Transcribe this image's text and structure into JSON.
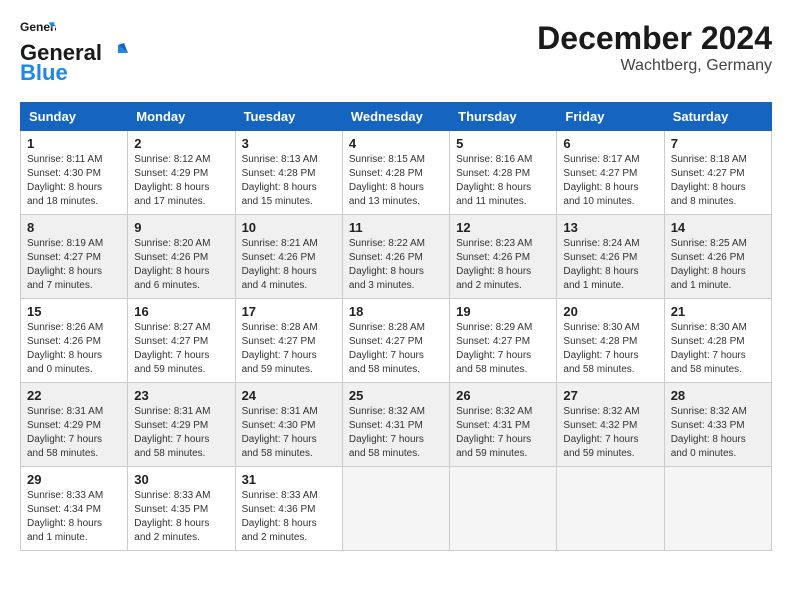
{
  "logo": {
    "line1": "General",
    "line2": "Blue"
  },
  "title": "December 2024",
  "location": "Wachtberg, Germany",
  "days_of_week": [
    "Sunday",
    "Monday",
    "Tuesday",
    "Wednesday",
    "Thursday",
    "Friday",
    "Saturday"
  ],
  "weeks": [
    [
      {
        "day": "1",
        "sunrise": "8:11 AM",
        "sunset": "4:30 PM",
        "daylight": "8 hours and 18 minutes."
      },
      {
        "day": "2",
        "sunrise": "8:12 AM",
        "sunset": "4:29 PM",
        "daylight": "8 hours and 17 minutes."
      },
      {
        "day": "3",
        "sunrise": "8:13 AM",
        "sunset": "4:28 PM",
        "daylight": "8 hours and 15 minutes."
      },
      {
        "day": "4",
        "sunrise": "8:15 AM",
        "sunset": "4:28 PM",
        "daylight": "8 hours and 13 minutes."
      },
      {
        "day": "5",
        "sunrise": "8:16 AM",
        "sunset": "4:28 PM",
        "daylight": "8 hours and 11 minutes."
      },
      {
        "day": "6",
        "sunrise": "8:17 AM",
        "sunset": "4:27 PM",
        "daylight": "8 hours and 10 minutes."
      },
      {
        "day": "7",
        "sunrise": "8:18 AM",
        "sunset": "4:27 PM",
        "daylight": "8 hours and 8 minutes."
      }
    ],
    [
      {
        "day": "8",
        "sunrise": "8:19 AM",
        "sunset": "4:27 PM",
        "daylight": "8 hours and 7 minutes."
      },
      {
        "day": "9",
        "sunrise": "8:20 AM",
        "sunset": "4:26 PM",
        "daylight": "8 hours and 6 minutes."
      },
      {
        "day": "10",
        "sunrise": "8:21 AM",
        "sunset": "4:26 PM",
        "daylight": "8 hours and 4 minutes."
      },
      {
        "day": "11",
        "sunrise": "8:22 AM",
        "sunset": "4:26 PM",
        "daylight": "8 hours and 3 minutes."
      },
      {
        "day": "12",
        "sunrise": "8:23 AM",
        "sunset": "4:26 PM",
        "daylight": "8 hours and 2 minutes."
      },
      {
        "day": "13",
        "sunrise": "8:24 AM",
        "sunset": "4:26 PM",
        "daylight": "8 hours and 1 minute."
      },
      {
        "day": "14",
        "sunrise": "8:25 AM",
        "sunset": "4:26 PM",
        "daylight": "8 hours and 1 minute."
      }
    ],
    [
      {
        "day": "15",
        "sunrise": "8:26 AM",
        "sunset": "4:26 PM",
        "daylight": "8 hours and 0 minutes."
      },
      {
        "day": "16",
        "sunrise": "8:27 AM",
        "sunset": "4:27 PM",
        "daylight": "7 hours and 59 minutes."
      },
      {
        "day": "17",
        "sunrise": "8:28 AM",
        "sunset": "4:27 PM",
        "daylight": "7 hours and 59 minutes."
      },
      {
        "day": "18",
        "sunrise": "8:28 AM",
        "sunset": "4:27 PM",
        "daylight": "7 hours and 58 minutes."
      },
      {
        "day": "19",
        "sunrise": "8:29 AM",
        "sunset": "4:27 PM",
        "daylight": "7 hours and 58 minutes."
      },
      {
        "day": "20",
        "sunrise": "8:30 AM",
        "sunset": "4:28 PM",
        "daylight": "7 hours and 58 minutes."
      },
      {
        "day": "21",
        "sunrise": "8:30 AM",
        "sunset": "4:28 PM",
        "daylight": "7 hours and 58 minutes."
      }
    ],
    [
      {
        "day": "22",
        "sunrise": "8:31 AM",
        "sunset": "4:29 PM",
        "daylight": "7 hours and 58 minutes."
      },
      {
        "day": "23",
        "sunrise": "8:31 AM",
        "sunset": "4:29 PM",
        "daylight": "7 hours and 58 minutes."
      },
      {
        "day": "24",
        "sunrise": "8:31 AM",
        "sunset": "4:30 PM",
        "daylight": "7 hours and 58 minutes."
      },
      {
        "day": "25",
        "sunrise": "8:32 AM",
        "sunset": "4:31 PM",
        "daylight": "7 hours and 58 minutes."
      },
      {
        "day": "26",
        "sunrise": "8:32 AM",
        "sunset": "4:31 PM",
        "daylight": "7 hours and 59 minutes."
      },
      {
        "day": "27",
        "sunrise": "8:32 AM",
        "sunset": "4:32 PM",
        "daylight": "7 hours and 59 minutes."
      },
      {
        "day": "28",
        "sunrise": "8:32 AM",
        "sunset": "4:33 PM",
        "daylight": "8 hours and 0 minutes."
      }
    ],
    [
      {
        "day": "29",
        "sunrise": "8:33 AM",
        "sunset": "4:34 PM",
        "daylight": "8 hours and 1 minute."
      },
      {
        "day": "30",
        "sunrise": "8:33 AM",
        "sunset": "4:35 PM",
        "daylight": "8 hours and 2 minutes."
      },
      {
        "day": "31",
        "sunrise": "8:33 AM",
        "sunset": "4:36 PM",
        "daylight": "8 hours and 2 minutes."
      },
      null,
      null,
      null,
      null
    ]
  ]
}
